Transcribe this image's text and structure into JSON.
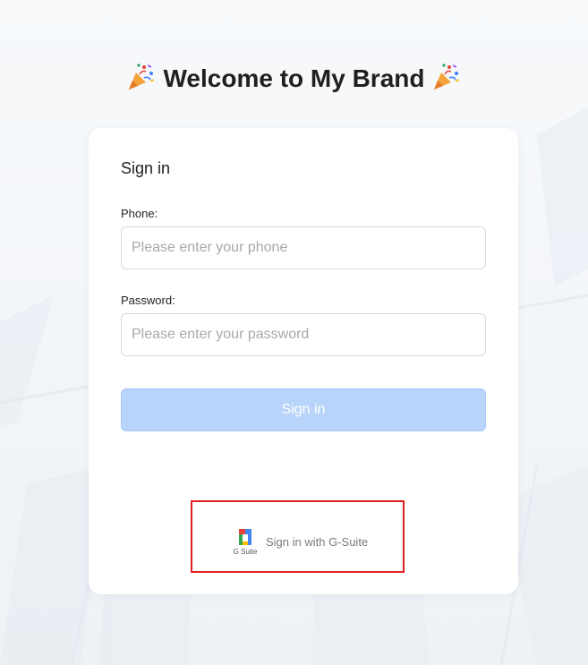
{
  "header": {
    "title": "Welcome to My Brand",
    "emoji_left": "party-popper-icon",
    "emoji_right": "party-popper-icon"
  },
  "form": {
    "title": "Sign in",
    "phone": {
      "label": "Phone:",
      "value": "",
      "placeholder": "Please enter your phone"
    },
    "password": {
      "label": "Password:",
      "value": "",
      "placeholder": "Please enter your password"
    },
    "submit_label": "Sign in",
    "submit_state": "disabled"
  },
  "sso": {
    "label": "Sign in with G-Suite",
    "icon": "gsuite-logo-icon",
    "logo_text": "G Suite",
    "highlight_color": "#e02020"
  },
  "colors": {
    "primary_disabled": "#b8d4fb",
    "card_bg": "#ffffff",
    "page_bg": "#f3f6f9"
  }
}
